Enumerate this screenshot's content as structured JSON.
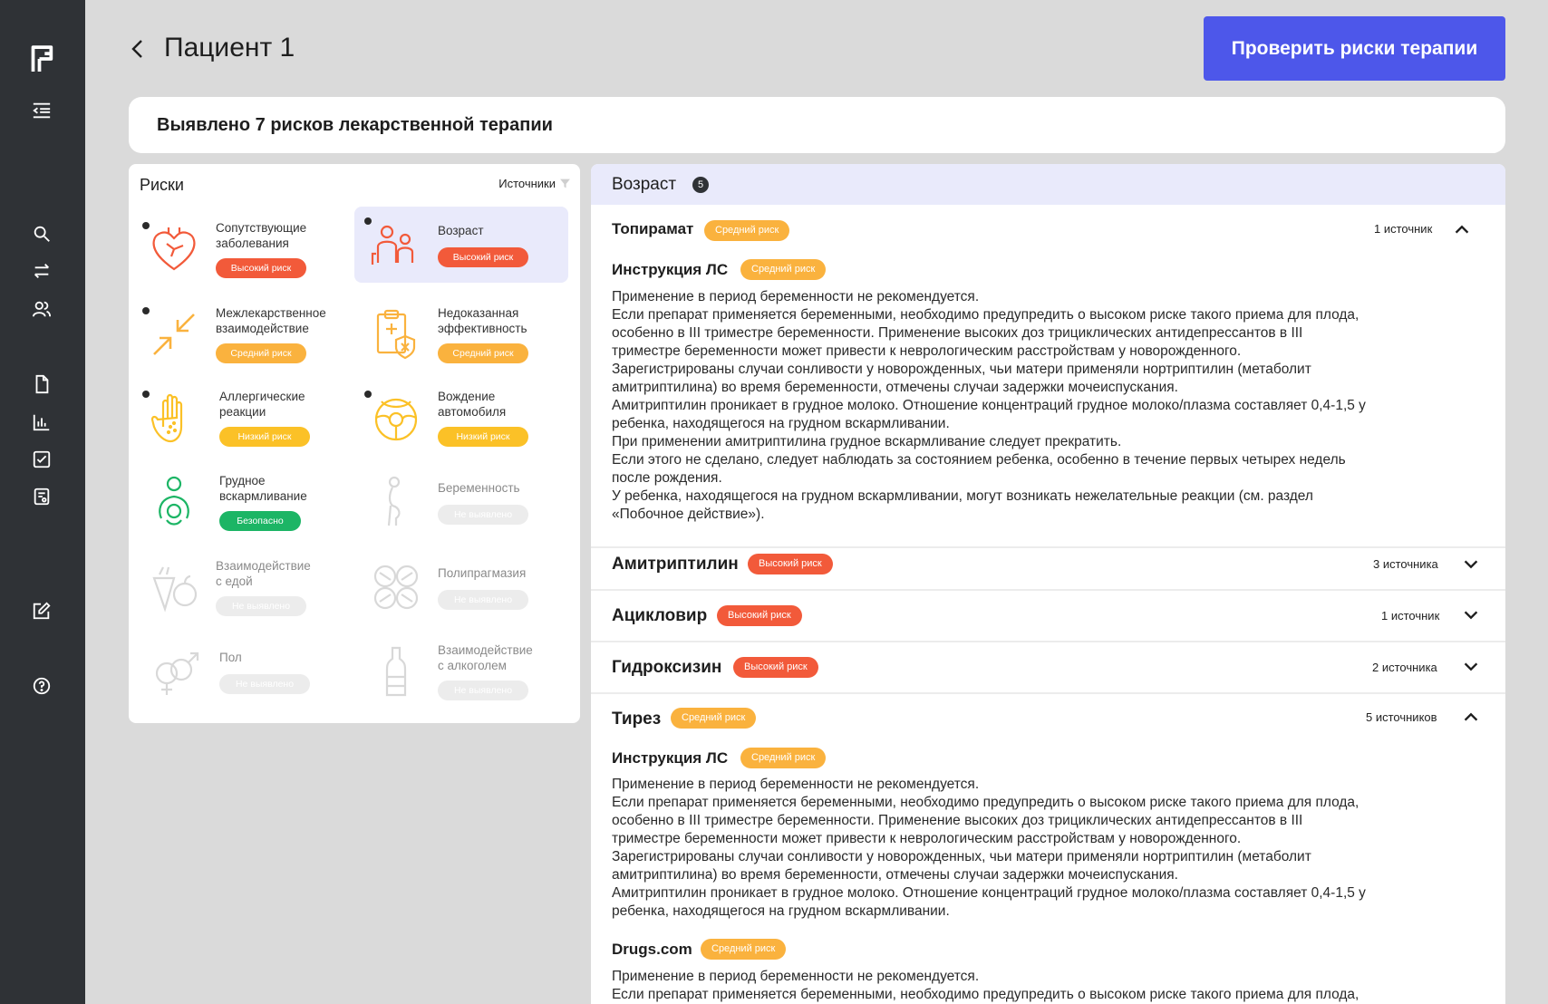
{
  "sidebar": {
    "logo": "logo-icon",
    "items": [
      {
        "name": "menu-collapse-icon"
      },
      {
        "name": "search-icon"
      },
      {
        "name": "swap-icon"
      },
      {
        "name": "patients-icon"
      },
      {
        "name": "document-icon"
      },
      {
        "name": "chart-icon"
      },
      {
        "name": "checklist-icon"
      },
      {
        "name": "report-icon"
      },
      {
        "name": "edit-icon"
      },
      {
        "name": "help-icon"
      }
    ]
  },
  "header": {
    "title": "Пациент 1",
    "check_button": "Проверить риски терапии"
  },
  "summary": "Выявлено 7 рисков лекарственной терапии",
  "risks_panel": {
    "title": "Риски",
    "sources_filter": "Источники",
    "items": [
      {
        "name": "Сопутствующие\nзаболевания",
        "badge": "Высокий риск",
        "level": "high"
      },
      {
        "name": "Возраст",
        "badge": "Высокий риск",
        "level": "high"
      },
      {
        "name": "Межлекарственное\nвзаимодействие",
        "badge": "Средний риск",
        "level": "mid"
      },
      {
        "name": "Недоказанная\nэффективность",
        "badge": "Средний риск",
        "level": "mid"
      },
      {
        "name": "Аллергические\nреакции",
        "badge": "Низкий риск",
        "level": "low"
      },
      {
        "name": "Вождение\nавтомобиля",
        "badge": "Низкий риск",
        "level": "low"
      },
      {
        "name": "Грудное\nвскармливание",
        "badge": "Безопасно",
        "level": "safe"
      },
      {
        "name": "Беременность",
        "badge": "Не выявлено",
        "level": "none"
      },
      {
        "name": "Взаимодействие\nс едой",
        "badge": "Не выявлено",
        "level": "none"
      },
      {
        "name": "Полипрагмазия",
        "badge": "Не выявлено",
        "level": "none"
      },
      {
        "name": "Пол",
        "badge": "Не выявлено",
        "level": "none"
      },
      {
        "name": "Взаимодействие\nс алкоголем",
        "badge": "Не выявлено",
        "level": "none"
      }
    ]
  },
  "detail": {
    "title": "Возраст",
    "count": "5",
    "drugs": [
      {
        "name": "Топирамат",
        "badge": "Средний риск",
        "sources": "1 источник",
        "expanded": true,
        "sections": [
          {
            "title": "Инструкция ЛС",
            "badge": "Средний риск",
            "lines": [
              "Применение в период беременности не рекомендуется.",
              "Если препарат применяется беременными, необходимо предупредить о высоком риске такого приема для плода,",
              "особенно в III триместре беременности. Применение высоких доз трициклических антидепрессантов в III",
              "триместре беременности может привести к неврологическим расстройствам у новорожденного.",
              "Зарегистрированы случаи сонливости у новорожденных, чьи матери применяли нортриптилин (метаболит",
              "амитриптилина) во время беременности, отмечены случаи задержки мочеиспускания.",
              "Амитриптилин проникает в грудное молоко. Отношение концентраций грудное молоко/плазма составляет 0,4-1,5 у",
              "ребенка, находящегося на грудном вскармливании.",
              "При применении амитриптилина грудное вскармливание следует прекратить.",
              "Если этого не сделано, следует наблюдать за состоянием ребенка, особенно в течение первых четырех недель",
              "после рождения.",
              "У ребенка, находящегося на грудном вскармливании, могут возникать нежелательные реакции (см. раздел",
              "«Побочное действие»)."
            ]
          }
        ]
      },
      {
        "name": "Амитриптилин",
        "badge": "Высокий риск",
        "sources": "3 источника",
        "expanded": false
      },
      {
        "name": "Ацикловир",
        "badge": "Высокий риск",
        "sources": "1 источник",
        "expanded": false
      },
      {
        "name": "Гидроксизин",
        "badge": "Высокий риск",
        "sources": "2 источника",
        "expanded": false
      },
      {
        "name": "Тирез",
        "badge": "Средний риск",
        "sources": "5 источников",
        "expanded": true,
        "sections": [
          {
            "title": "Инструкция ЛС",
            "badge": "Средний риск",
            "lines": [
              "Применение в период беременности не рекомендуется.",
              "Если препарат применяется беременными, необходимо предупредить о высоком риске такого приема для плода,",
              "особенно в III триместре беременности. Применение высоких доз трициклических антидепрессантов в III",
              "триместре беременности может привести к неврологическим расстройствам у новорожденного.",
              "Зарегистрированы случаи сонливости у новорожденных, чьи матери применяли нортриптилин (метаболит",
              "амитриптилина) во время беременности, отмечены случаи задержки мочеиспускания.",
              "Амитриптилин проникает в грудное молоко. Отношение концентраций грудное молоко/плазма составляет 0,4-1,5 у",
              "ребенка, находящегося на грудном вскармливании."
            ]
          },
          {
            "title": "Drugs.com",
            "badge": "Средний риск",
            "lines": [
              "Применение в период беременности не рекомендуется.",
              "Если препарат применяется беременными, необходимо предупредить о высоком риске такого приема для плода,"
            ]
          }
        ]
      }
    ]
  },
  "colors": {
    "accent": "#4d57ea",
    "high": "#f25a3a",
    "mid": "#fab23e",
    "low": "#fbc127",
    "safe": "#1cb565",
    "none": "#ececec"
  }
}
